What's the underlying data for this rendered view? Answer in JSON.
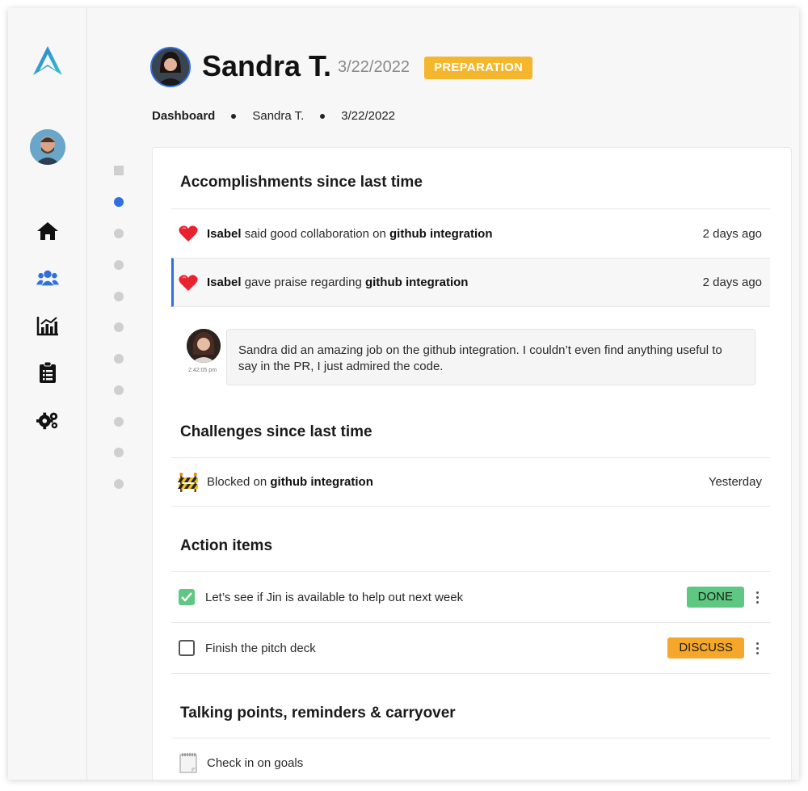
{
  "header": {
    "name": "Sandra T.",
    "date": "3/22/2022",
    "status": "PREPARATION"
  },
  "breadcrumb": [
    "Dashboard",
    "Sandra T.",
    "3/22/2022"
  ],
  "sidebar": {
    "nav": [
      {
        "icon": "home-icon"
      },
      {
        "icon": "people-icon",
        "active": true
      },
      {
        "icon": "chart-icon"
      },
      {
        "icon": "clipboard-icon"
      },
      {
        "icon": "settings-icon"
      }
    ]
  },
  "accomplishments": {
    "title": "Accomplishments since last time",
    "items": [
      {
        "actor": "Isabel",
        "verb": " said good collaboration on ",
        "subject": "github integration",
        "time": "2 days ago"
      },
      {
        "actor": "Isabel",
        "verb": " gave praise regarding ",
        "subject": "github integration",
        "time": "2 days ago"
      }
    ],
    "comment": {
      "text": "Sandra did an amazing job on the github integration. I couldn’t even find anything useful to say in the PR, I just admired the code.",
      "timestamp": "2:42:05 pm"
    }
  },
  "challenges": {
    "title": "Challenges since last time",
    "items": [
      {
        "prefix": "Blocked on ",
        "subject": "github integration",
        "time": "Yesterday"
      }
    ]
  },
  "action_items": {
    "title": "Action items",
    "items": [
      {
        "text": "Let’s see if Jin is available to help out next week",
        "checked": true,
        "tag": "DONE"
      },
      {
        "text": "Finish the pitch deck",
        "checked": false,
        "tag": "DISCUSS"
      }
    ]
  },
  "talking_points": {
    "title": "Talking points, reminders & carryover",
    "items": [
      {
        "text": "Check in on goals"
      }
    ]
  },
  "colors": {
    "accent": "#2f6fe0",
    "preparation": "#f4b62d",
    "done": "#5ec781",
    "discuss": "#f4a72b"
  }
}
